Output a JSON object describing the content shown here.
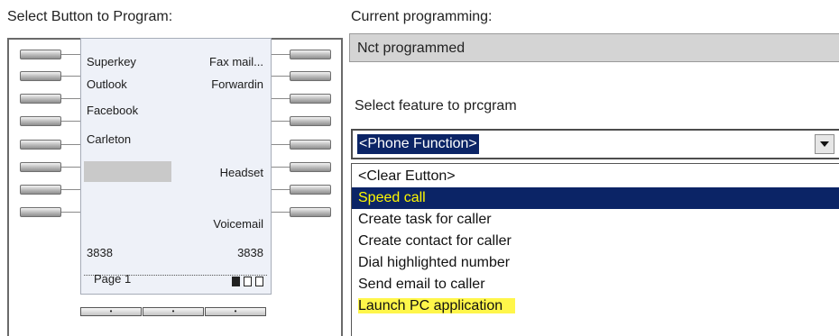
{
  "left_header": "Select Button to Program:",
  "right_header": "Current programming:",
  "current_programming": "Nct programmed",
  "feature_label": "Select feature to prcgram",
  "feature_select": {
    "value": "<Phone Function>",
    "icon": "chevron-down-icon"
  },
  "feature_options": [
    {
      "label": "<Clear Eutton>",
      "state": "normal"
    },
    {
      "label": "Speed call",
      "state": "selected"
    },
    {
      "label": "Create task for caller",
      "state": "normal"
    },
    {
      "label": "Create contact for caller",
      "state": "normal"
    },
    {
      "label": "Dial highlighted number",
      "state": "normal"
    },
    {
      "label": "Send email to caller",
      "state": "normal"
    },
    {
      "label": "Launch PC application",
      "state": "highlighted"
    }
  ],
  "phone": {
    "left_labels": [
      "Superkey",
      "Outlook",
      "Facebook",
      "Carleton",
      "",
      "",
      "",
      "3838"
    ],
    "right_labels": [
      "Fax mail...",
      "Forwardin",
      "",
      "",
      "Headset",
      "",
      "Voicemail",
      "3838"
    ],
    "page_label": "Page 1",
    "page_icons": [
      "page-filled-icon",
      "page-outline-icon",
      "page-outline-icon"
    ],
    "nav_buttons": [
      "•",
      "•",
      "•"
    ]
  },
  "colors": {
    "selection_bg": "#0b2466",
    "selection_text": "#fff800",
    "highlight": "#fff64a",
    "panel_gray": "#d4d4d4"
  }
}
